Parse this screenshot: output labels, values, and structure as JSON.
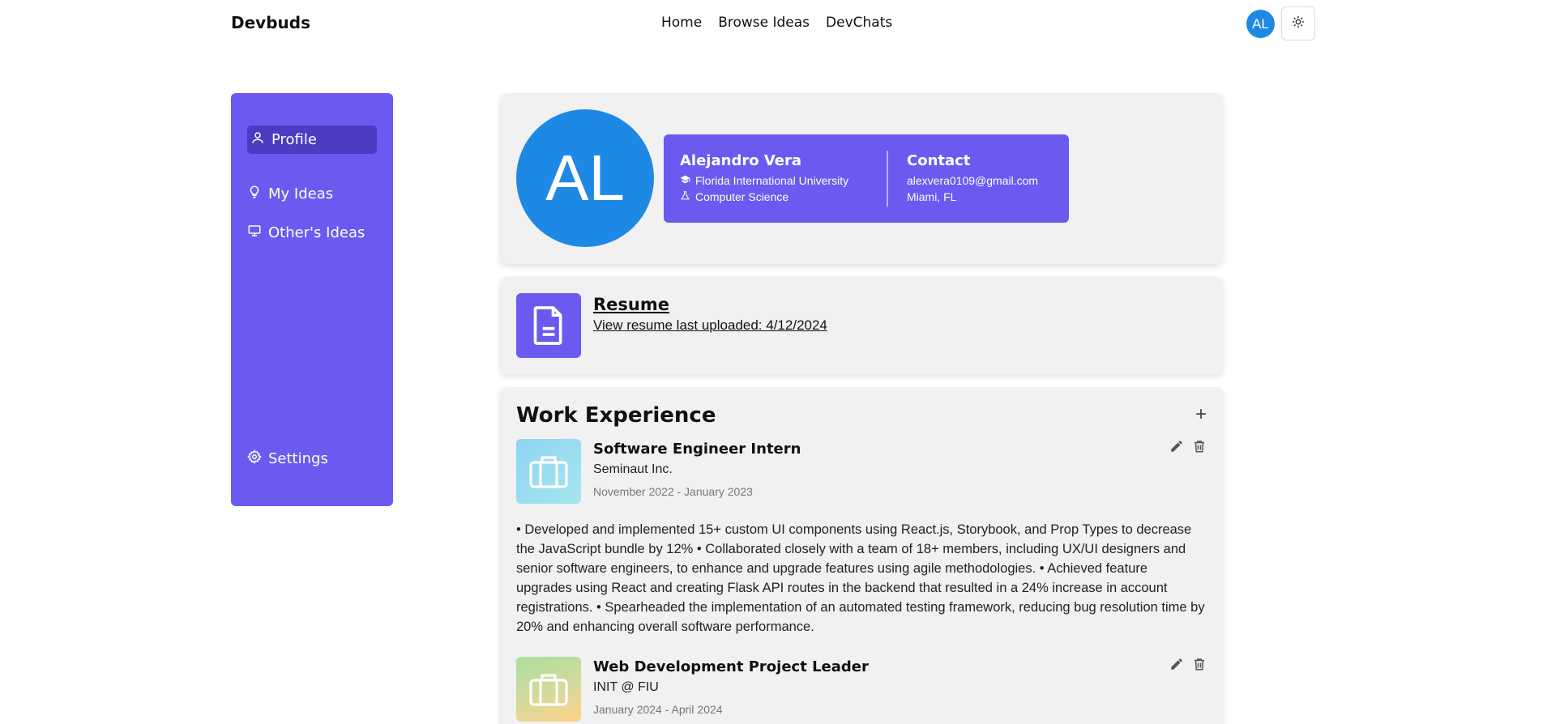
{
  "header": {
    "brand": "Devbuds",
    "nav": [
      "Home",
      "Browse Ideas",
      "DevChats"
    ],
    "avatar_initials": "AL",
    "theme_icon": "sun-icon"
  },
  "sidebar": {
    "items": [
      {
        "label": "Profile",
        "icon": "user-icon"
      },
      {
        "label": "My Ideas",
        "icon": "lightbulb-icon"
      },
      {
        "label": "Other's Ideas",
        "icon": "monitor-icon"
      }
    ],
    "settings_label": "Settings",
    "settings_icon": "gear-icon"
  },
  "profile": {
    "initials": "AL",
    "name": "Alejandro Vera",
    "university": "Florida International University",
    "major": "Computer Science",
    "contact_heading": "Contact",
    "email": "alexvera0109@gmail.com",
    "location": "Miami, FL"
  },
  "resume": {
    "title": "Resume",
    "link_text": "View resume last uploaded: 4/12/2024"
  },
  "work": {
    "heading": "Work Experience",
    "add_label": "+",
    "jobs": [
      {
        "role": "Software Engineer Intern",
        "company": "Seminaut Inc.",
        "dates": "November 2022 - January 2023",
        "description": "• Developed and implemented 15+ custom UI components using React.js, Storybook, and Prop Types to decrease the JavaScript bundle by 12% • Collaborated closely with a team of 18+ members, including UX/UI designers and senior software engineers, to enhance and upgrade features using agile methodologies. • Achieved feature upgrades using React and creating Flask API routes in the backend that resulted in a 24% increase in account registrations. • Spearheaded the implementation of an automated testing framework, reducing bug resolution time by 20% and enhancing overall software performance."
      },
      {
        "role": "Web Development Project Leader",
        "company": "INIT @ FIU",
        "dates": "January 2024 - April 2024",
        "description": ""
      }
    ]
  }
}
